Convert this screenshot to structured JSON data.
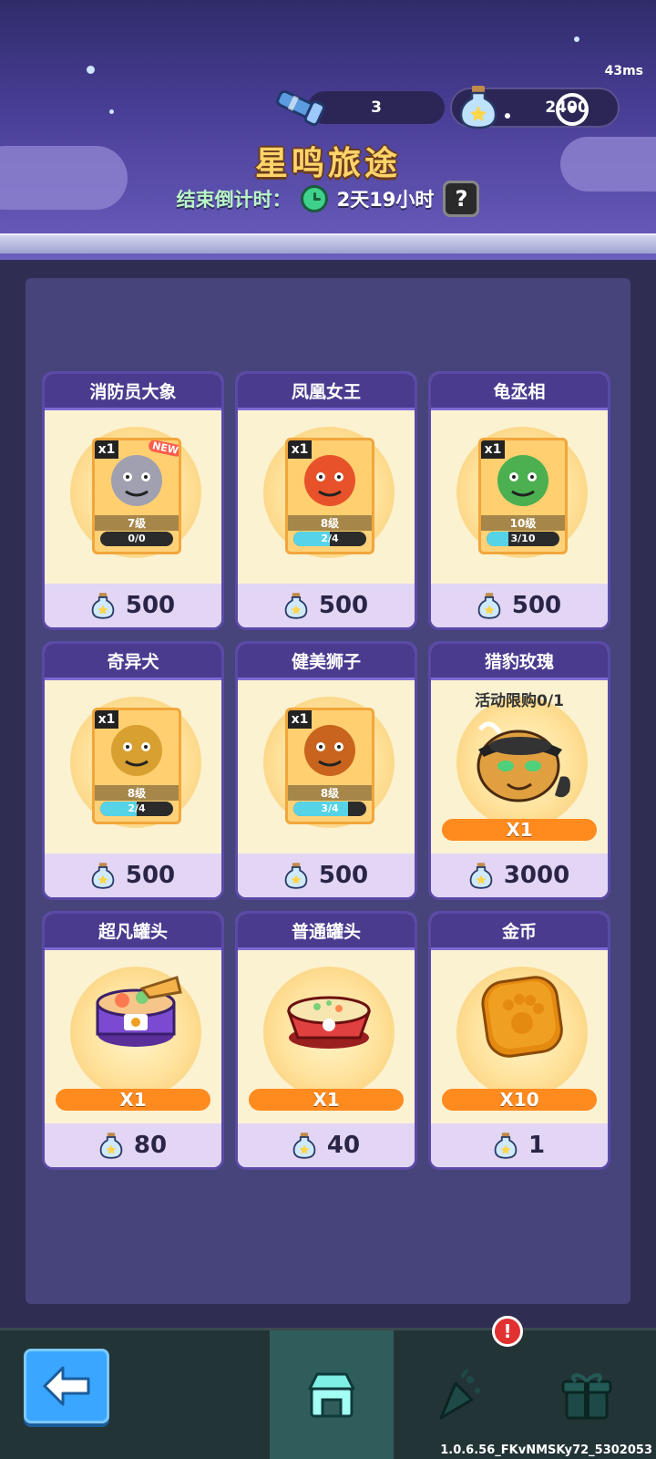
{
  "header": {
    "ping": "43ms",
    "telescope_count": "3",
    "star_bottle_count": "2400",
    "title": "星鸣旅途",
    "countdown_label": "结束倒计时：",
    "countdown_value": "2天19小时",
    "help_label": "?"
  },
  "shop": {
    "items": [
      {
        "name": "消防员大象",
        "kind": "hero",
        "count": "x1",
        "level": "7级",
        "progress_text": "0/0",
        "progress": 0,
        "new": "NEW",
        "price": "500",
        "art": "elephant-firefighter",
        "color": "#a0a0b0"
      },
      {
        "name": "凤凰女王",
        "kind": "hero",
        "count": "x1",
        "level": "8级",
        "progress_text": "2/4",
        "progress": 0.5,
        "price": "500",
        "art": "phoenix-queen",
        "color": "#e8522a"
      },
      {
        "name": "龟丞相",
        "kind": "hero",
        "count": "x1",
        "level": "10级",
        "progress_text": "3/10",
        "progress": 0.3,
        "price": "500",
        "art": "turtle-minister",
        "color": "#4caf50"
      },
      {
        "name": "奇异犬",
        "kind": "hero",
        "count": "x1",
        "level": "8级",
        "progress_text": "2/4",
        "progress": 0.5,
        "price": "500",
        "art": "strange-dog",
        "color": "#d8a030"
      },
      {
        "name": "健美狮子",
        "kind": "hero",
        "count": "x1",
        "level": "8级",
        "progress_text": "3/4",
        "progress": 0.75,
        "price": "500",
        "art": "bodybuilder-lion",
        "color": "#c8641e"
      },
      {
        "name": "猎豹玫瑰",
        "kind": "limited",
        "limit": "活动限购0/1",
        "qty": "X1",
        "price": "3000",
        "art": "cheetah-rose",
        "color": "#e0a040"
      },
      {
        "name": "超凡罐头",
        "kind": "item",
        "qty": "X1",
        "price": "80",
        "art": "super-can",
        "color": "#7a4bd0"
      },
      {
        "name": "普通罐头",
        "kind": "item",
        "qty": "X1",
        "price": "40",
        "art": "normal-can",
        "color": "#e04040"
      },
      {
        "name": "金币",
        "kind": "item",
        "qty": "X10",
        "price": "1",
        "art": "gold-coin",
        "color": "#f0a020"
      }
    ]
  },
  "nav": {
    "badge": "!",
    "version": "1.0.6.56_FKvNMSKy72_5302053"
  }
}
